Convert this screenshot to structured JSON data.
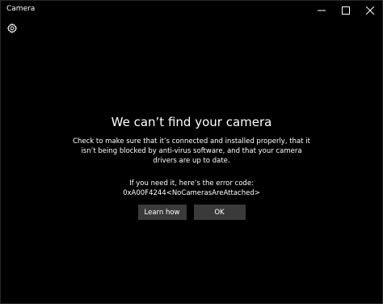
{
  "window": {
    "title": "Camera"
  },
  "caption": {
    "minimize_icon": "minimize-icon",
    "maximize_icon": "maximize-icon",
    "close_icon": "close-icon"
  },
  "toolbar": {
    "settings_icon": "gear-icon"
  },
  "message": {
    "heading": "We can’t find your camera",
    "body": "Check to make sure that it’s connected and installed properly, that it isn’t being blocked by anti-virus software, and that your camera drivers are up to date.",
    "error_intro": "If you need it, here’s the error code:",
    "error_code": "0xA00F4244<NoCamerasAreAttached>"
  },
  "actions": {
    "learn_how_label": "Learn how",
    "ok_label": "OK"
  },
  "colors": {
    "background": "#000000",
    "text": "#ffffff",
    "button_bg": "#3a3a3a"
  }
}
